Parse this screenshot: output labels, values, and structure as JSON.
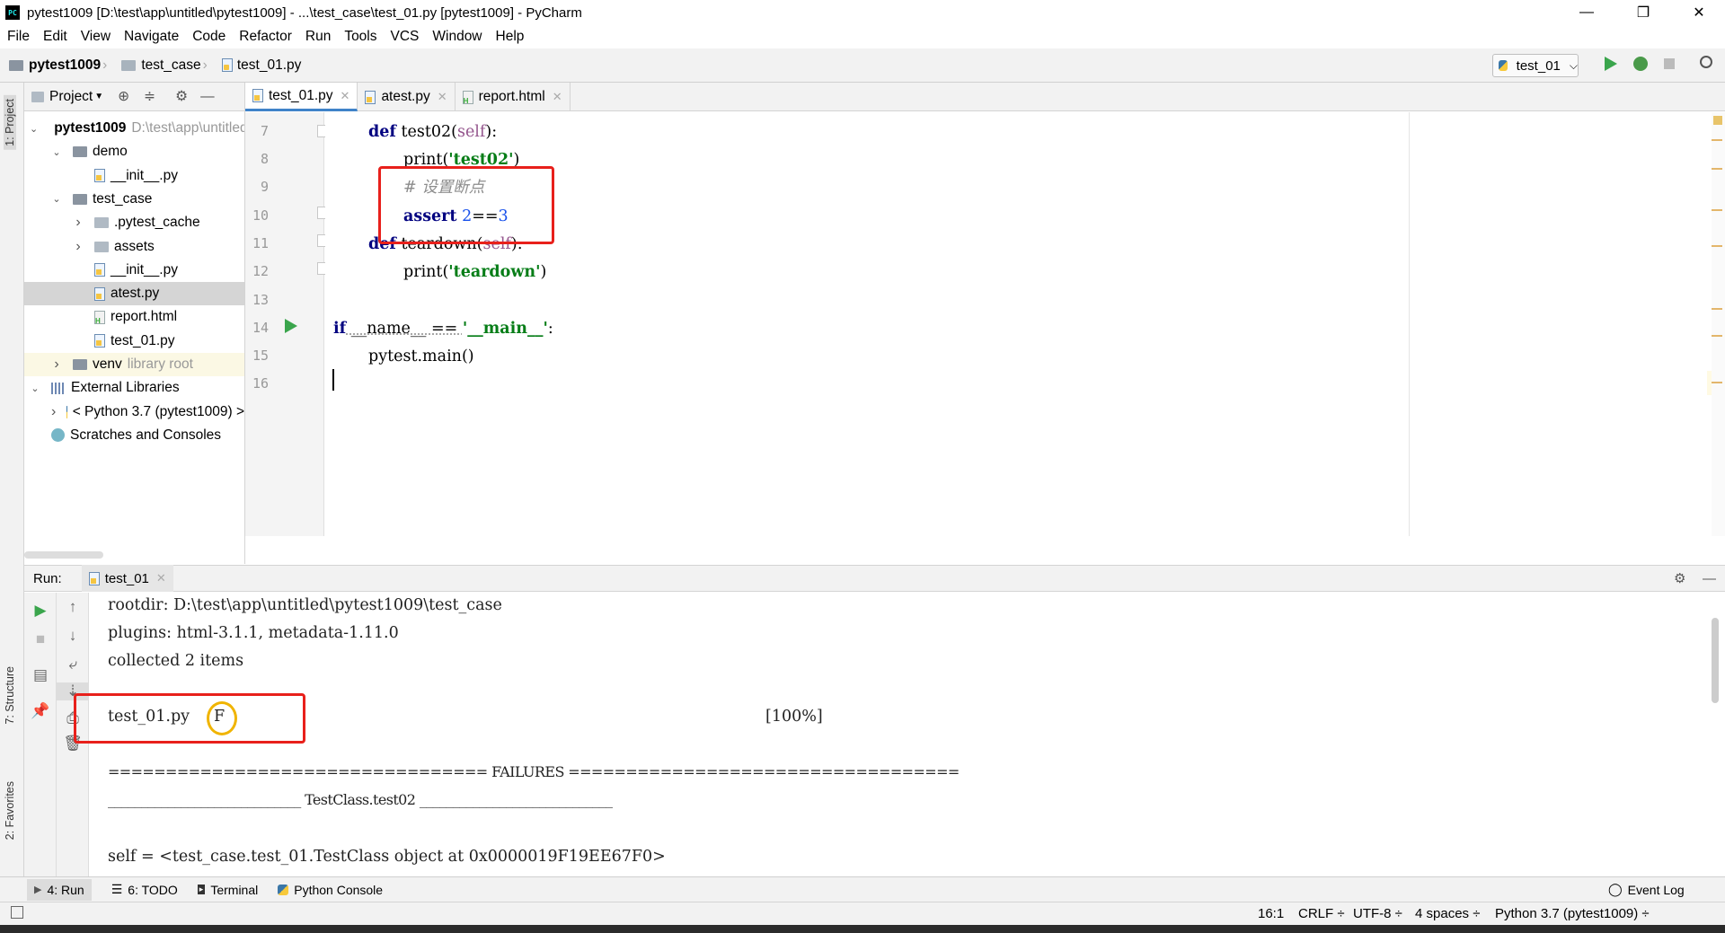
{
  "window": {
    "title": "pytest1009 [D:\\test\\app\\untitled\\pytest1009] - ...\\test_case\\test_01.py [pytest1009] - PyCharm",
    "app_icon_text": "PC",
    "minimize": "—",
    "restore": "❐",
    "close": "✕"
  },
  "menu": [
    "File",
    "Edit",
    "View",
    "Navigate",
    "Code",
    "Refactor",
    "Run",
    "Tools",
    "VCS",
    "Window",
    "Help"
  ],
  "breadcrumb": {
    "project": "pytest1009",
    "folder": "test_case",
    "file": "test_01.py"
  },
  "run_config": {
    "name": "test_01",
    "dropdown": "⌵"
  },
  "toolbar_icons": [
    "run-icon",
    "debug-icon",
    "stop-icon",
    "search-icon"
  ],
  "side_tabs": {
    "project": "1: Project",
    "structure": "7: Structure",
    "favorites": "2: Favorites"
  },
  "project_panel": {
    "header": "Project",
    "tree": [
      {
        "label": "pytest1009",
        "muted": "D:\\test\\app\\untitled",
        "icon": "folder",
        "level": 0,
        "expanded": true,
        "bold": true
      },
      {
        "label": "demo",
        "icon": "folder",
        "level": 1,
        "expanded": true
      },
      {
        "label": "__init__.py",
        "icon": "py",
        "level": 2
      },
      {
        "label": "test_case",
        "icon": "folder",
        "level": 1,
        "expanded": true
      },
      {
        "label": ".pytest_cache",
        "icon": "folder",
        "level": 2,
        "expanded": false
      },
      {
        "label": "assets",
        "icon": "folder",
        "level": 2,
        "expanded": false
      },
      {
        "label": "__init__.py",
        "icon": "py",
        "level": 2
      },
      {
        "label": "atest.py",
        "icon": "py",
        "level": 2,
        "selected": true
      },
      {
        "label": "report.html",
        "icon": "html",
        "level": 2
      },
      {
        "label": "test_01.py",
        "icon": "py",
        "level": 2
      },
      {
        "label": "venv",
        "muted": "library root",
        "icon": "folder",
        "level": 1,
        "expanded": false,
        "venv": true
      },
      {
        "label": "External Libraries",
        "icon": "lib",
        "level": 0,
        "expanded": true
      },
      {
        "label": "< Python 3.7 (pytest1009) >",
        "icon": "pyth",
        "level": 1,
        "expanded": false
      },
      {
        "label": "Scratches and Consoles",
        "icon": "scratch",
        "level": 0
      }
    ]
  },
  "editor_tabs": [
    {
      "label": "test_01.py",
      "active": true
    },
    {
      "label": "atest.py",
      "active": false
    },
    {
      "label": "report.html",
      "active": false
    }
  ],
  "editor": {
    "line_numbers": [
      "7",
      "8",
      "9",
      "10",
      "11",
      "12",
      "13",
      "14",
      "15",
      "16"
    ],
    "lines": {
      "l7": {
        "kw": "def",
        "name": " test02(",
        "self": "self",
        "end": "):"
      },
      "l8": {
        "fn": "print(",
        "str": "'test02'",
        "end": ")"
      },
      "l9": {
        "cmt": "# 设置断点"
      },
      "l10": {
        "kw": "assert",
        "sp": " ",
        "num1": "2",
        "op": "==",
        "num2": "3"
      },
      "l11": {
        "kw": "def",
        "name": " teardown(",
        "self": "self",
        "end": "):"
      },
      "l12": {
        "fn": "print(",
        "str": "'teardown'",
        "end": ")"
      },
      "l14": {
        "kw": "if",
        "name": " __name__ == ",
        "str": "'__main__'",
        "end": ":"
      },
      "l15": {
        "fn": "pytest.main()"
      }
    }
  },
  "run_panel": {
    "label": "Run:",
    "tab": "test_01",
    "console": [
      "rootdir: D:\\test\\app\\untitled\\pytest1009\\test_case",
      "plugins: html-3.1.1, metadata-1.11.0",
      "collected 2 items",
      "",
      "test_01.py",
      "F",
      "[100%]",
      "",
      "================================= FAILURES ==================================",
      "_____________________________ TestClass.test02 _____________________________",
      "",
      "self = <test_case.test_01.TestClass object at 0x0000019F19EE67F0>"
    ]
  },
  "bottom_tabs": [
    {
      "label": "4: Run",
      "icon": "run-icon"
    },
    {
      "label": "6: TODO",
      "icon": "todo-icon"
    },
    {
      "label": "Terminal",
      "icon": "terminal-icon"
    },
    {
      "label": "Python Console",
      "icon": "python-console-icon"
    }
  ],
  "event_log": "Event Log",
  "status": {
    "position": "16:1",
    "line_sep": "CRLF ÷",
    "encoding": "UTF-8 ÷",
    "indent": "4 spaces ÷",
    "interpreter": "Python 3.7 (pytest1009) ÷"
  },
  "colors": {
    "accent": "#4083c9",
    "annotation_red": "#e8201b",
    "annotation_yellow": "#f0b400",
    "run_green": "#3aa54c"
  }
}
